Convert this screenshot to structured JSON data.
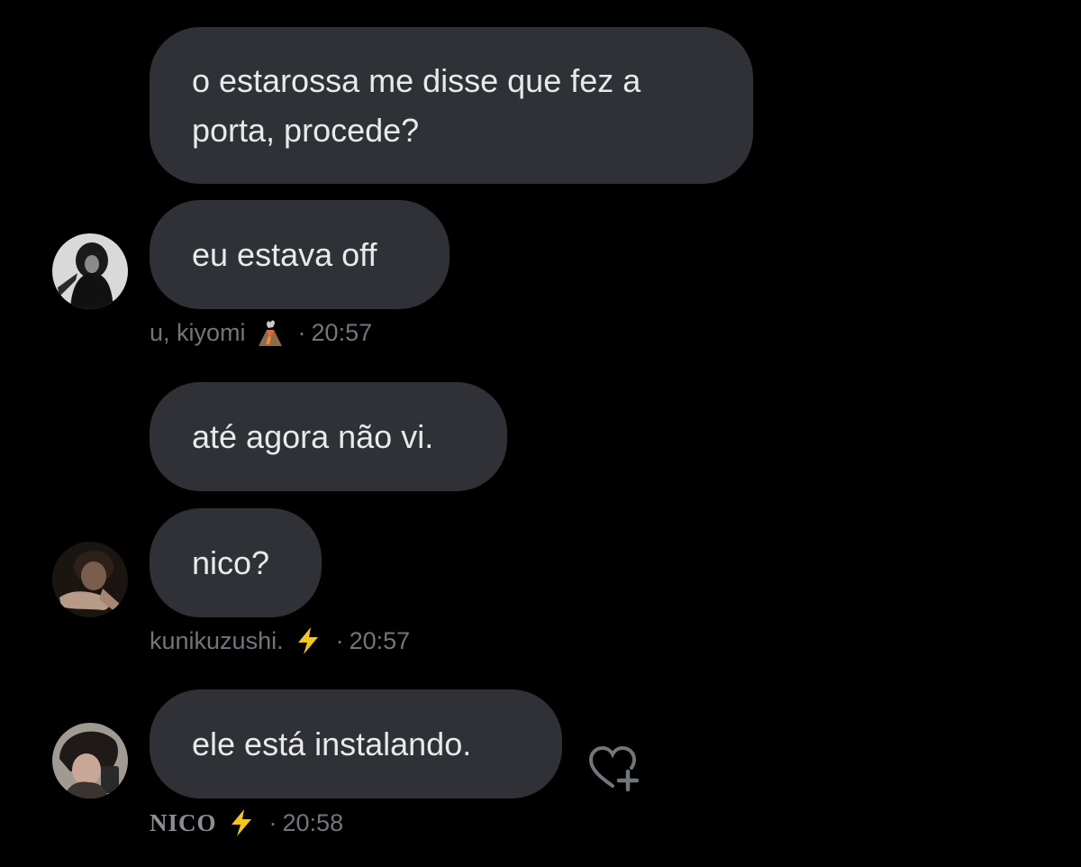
{
  "messages": [
    {
      "text": "o estarossa me disse que fez a porta, procede?"
    },
    {
      "text": "eu estava off"
    },
    {
      "text": "até agora não vi."
    },
    {
      "text": "nico?"
    },
    {
      "text": "ele está instalando."
    }
  ],
  "groups": [
    {
      "sender": "u, kiyomi",
      "emoji": "volcano-icon",
      "separator": "·",
      "time": "20:57"
    },
    {
      "sender": "kunikuzushi.",
      "emoji": "lightning-icon",
      "separator": "·",
      "time": "20:57"
    },
    {
      "sender": "NICO",
      "emoji": "lightning-icon",
      "separator": "·",
      "time": "20:58"
    }
  ],
  "actions": {
    "react_icon": "heart-plus-icon"
  },
  "colors": {
    "background": "#000000",
    "bubble": "#2f3136",
    "text": "#e7e9ea",
    "meta": "#71767b",
    "lightning": "#f5c518"
  }
}
